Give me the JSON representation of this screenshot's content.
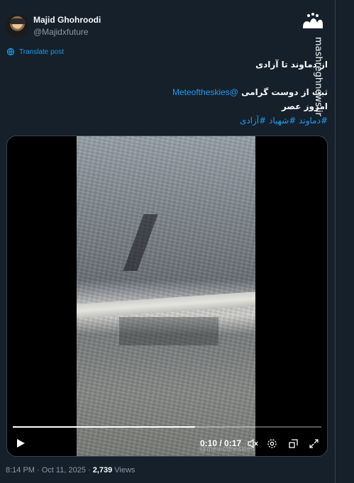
{
  "author": {
    "display_name": "Majid Ghohroodi",
    "handle": "@Majidxfuture"
  },
  "translate_label": "Translate post",
  "tweet": {
    "line1": "از دماوند تا آزادی",
    "line2_text": "ثبت از دوست گرامی ",
    "line2_mention": "@Meteoftheskies",
    "line3": "امروز عصر",
    "hashtags": "#دماوند #شهیاد #آزادی"
  },
  "video": {
    "watermark": "@meteoftheskies",
    "time": "0:10 / 0:17",
    "progress_fraction": 0.59
  },
  "meta": {
    "time": "8:14 PM",
    "sep1": " · ",
    "date": "Oct 11, 2025",
    "sep2": " · ",
    "views_count": "2,739",
    "views_label": " Views"
  },
  "watermark": {
    "logo_text": "مشرق",
    "site": "mashreghnews.ir"
  },
  "colors": {
    "background": "#15202b",
    "link": "#1d9bf0",
    "secondary_text": "#8b98a5"
  }
}
